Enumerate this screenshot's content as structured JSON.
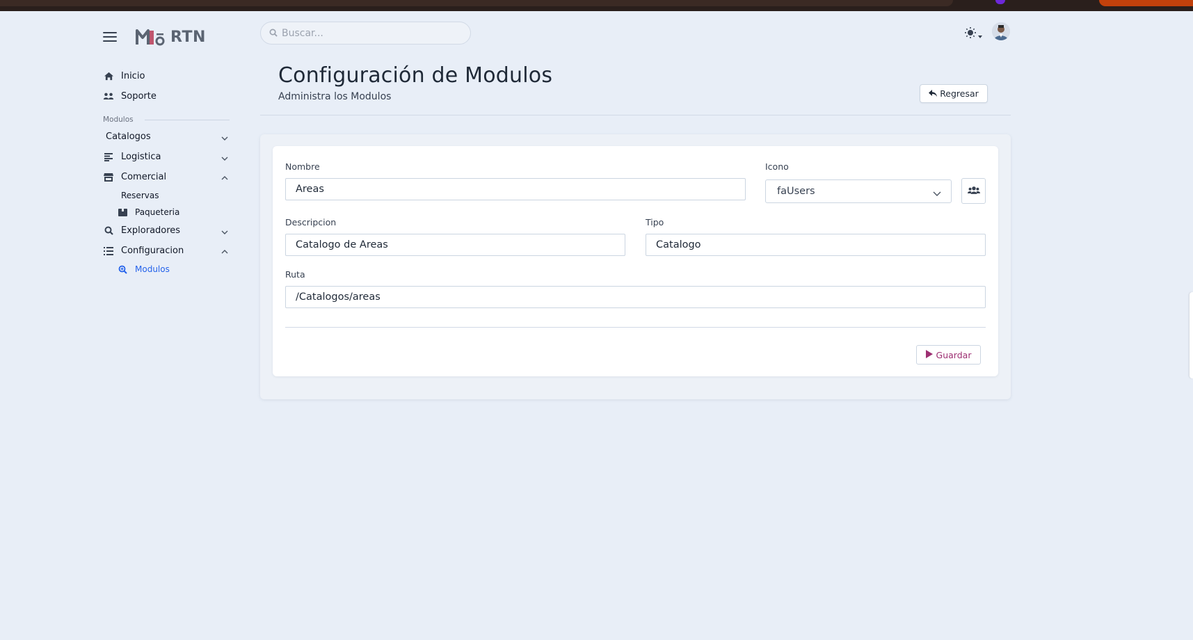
{
  "app": {
    "logo_text": "RTN",
    "logo_mark": "Mō"
  },
  "search": {
    "placeholder": "Buscar..."
  },
  "sidebar": {
    "items_top": [
      {
        "label": "Inicio",
        "icon": "home-icon"
      },
      {
        "label": "Soporte",
        "icon": "support-icon"
      }
    ],
    "section_label": "Modulos",
    "modules": [
      {
        "label": "Catalogos",
        "expanded": false
      },
      {
        "label": "Logistica",
        "expanded": false
      },
      {
        "label": "Comercial",
        "expanded": true,
        "children": [
          {
            "label": "Reservas"
          },
          {
            "label": "Paqueteria"
          }
        ]
      },
      {
        "label": "Exploradores",
        "expanded": false
      },
      {
        "label": "Configuracion",
        "expanded": true,
        "children": [
          {
            "label": "Modulos",
            "active": true
          }
        ]
      }
    ]
  },
  "header": {
    "title": "Configuración de Modulos",
    "subtitle": "Administra los Modulos",
    "back_label": "Regresar"
  },
  "form": {
    "nombre_label": "Nombre",
    "nombre_value": "Areas",
    "icono_label": "Icono",
    "icono_value": "faUsers",
    "descripcion_label": "Descripcion",
    "descripcion_value": "Catalogo de Areas",
    "tipo_label": "Tipo",
    "tipo_value": "Catalogo",
    "ruta_label": "Ruta",
    "ruta_value": "/Catalogos/areas",
    "save_label": "Guardar"
  },
  "colors": {
    "background": "#e8eef7",
    "active_link": "#2563eb",
    "save_accent": "#9d2f72",
    "logo_accent": "#c0566e"
  }
}
